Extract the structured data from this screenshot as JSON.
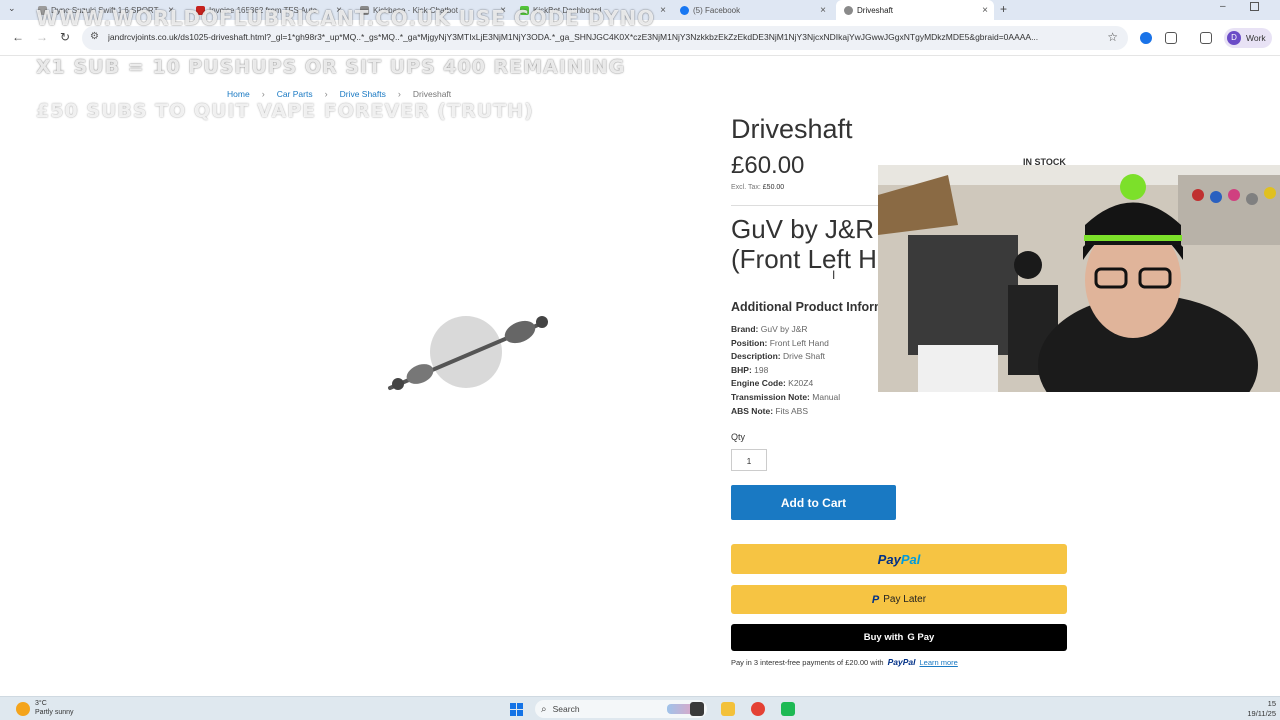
{
  "browser": {
    "tabs": [
      {
        "label": "Dyno Suzuki Swift 1.6 SPORT",
        "active": false,
        "favicon_color": "#9c9c9c"
      },
      {
        "label": "Invoice 165362 from TFS Auto",
        "active": false,
        "favicon_color": "#c5221f"
      },
      {
        "label": "Kickbase · Kick Chatbot",
        "active": false,
        "favicon_color": "#8a8a8a"
      },
      {
        "label": "KickBot Dashboard",
        "active": false,
        "favicon_color": "#53c43a"
      },
      {
        "label": "(5) Facebook",
        "active": false,
        "favicon_color": "#1877f2"
      },
      {
        "label": "Driveshaft",
        "active": true,
        "favicon_color": "#8a8a8a"
      }
    ],
    "url": "jandrcvjoints.co.uk/ds1025-driveshaft.html?_gl=1*gh98r3*_up*MQ..*_gs*MQ..*_ga*MjgyNjY3MTIxLjE3NjM1NjY3ODA.*_ga_SHNJGC4K0X*czE3NjM1NjY3NzkkbzEkZzEkdDE3NjM1NjY3NjcxNDIkajYwJGwwJGgxNTgyMDkzMDE5&gbraid=0AAAA...",
    "profile_initial": "D",
    "profile_label": "Work"
  },
  "overlay": {
    "line1": "WWW.WORLDOFLUBRICANT.CO.UK USE CODE DYNO",
    "line2": "X1 SUB = 10 PUSHUPS OR SIT UPS 400 REMAINING",
    "line3": "£50 SUBS TO QUIT VAPE FOREVER (TRUTH)"
  },
  "breadcrumb": [
    "Home",
    "Car Parts",
    "Drive Shafts",
    "Driveshaft"
  ],
  "product": {
    "title": "Driveshaft",
    "price": "£60.00",
    "excl_tax_label": "Excl. Tax:",
    "excl_tax_value": "£50.00",
    "stock": "IN STOCK",
    "subtitle_line1": "GuV by J&R Dr",
    "subtitle_line2": "(Front Left Ha",
    "additional_heading": "Additional Product Information",
    "attributes": [
      {
        "label": "Brand:",
        "value": "GuV by J&R"
      },
      {
        "label": "Position:",
        "value": "Front Left Hand"
      },
      {
        "label": "Description:",
        "value": "Drive Shaft"
      },
      {
        "label": "BHP:",
        "value": "198"
      },
      {
        "label": "Engine Code:",
        "value": "K20Z4"
      },
      {
        "label": "Transmission Note:",
        "value": "Manual"
      },
      {
        "label": "ABS Note:",
        "value": "Fits ABS"
      }
    ],
    "qty_label": "Qty",
    "qty_value": "1",
    "add_to_cart": "Add to Cart",
    "paypal_pay": "Pay",
    "paypal_pal": "Pal",
    "pay_later": "Pay Later",
    "gpay_prefix": "Buy with",
    "gpay_label": "G Pay",
    "paylater_msg": "Pay in 3 interest-free payments of £20.00 with",
    "paylater_brand": "PayPal",
    "learn_more": "Learn more"
  },
  "taskbar": {
    "temp": "3°C",
    "weather": "Partly sunny",
    "search_placeholder": "Search",
    "time": "15",
    "date": "19/11/25"
  },
  "colors": {
    "link": "#1979c3",
    "cart_button": "#1979c3",
    "paypal_yellow": "#f6c443"
  }
}
